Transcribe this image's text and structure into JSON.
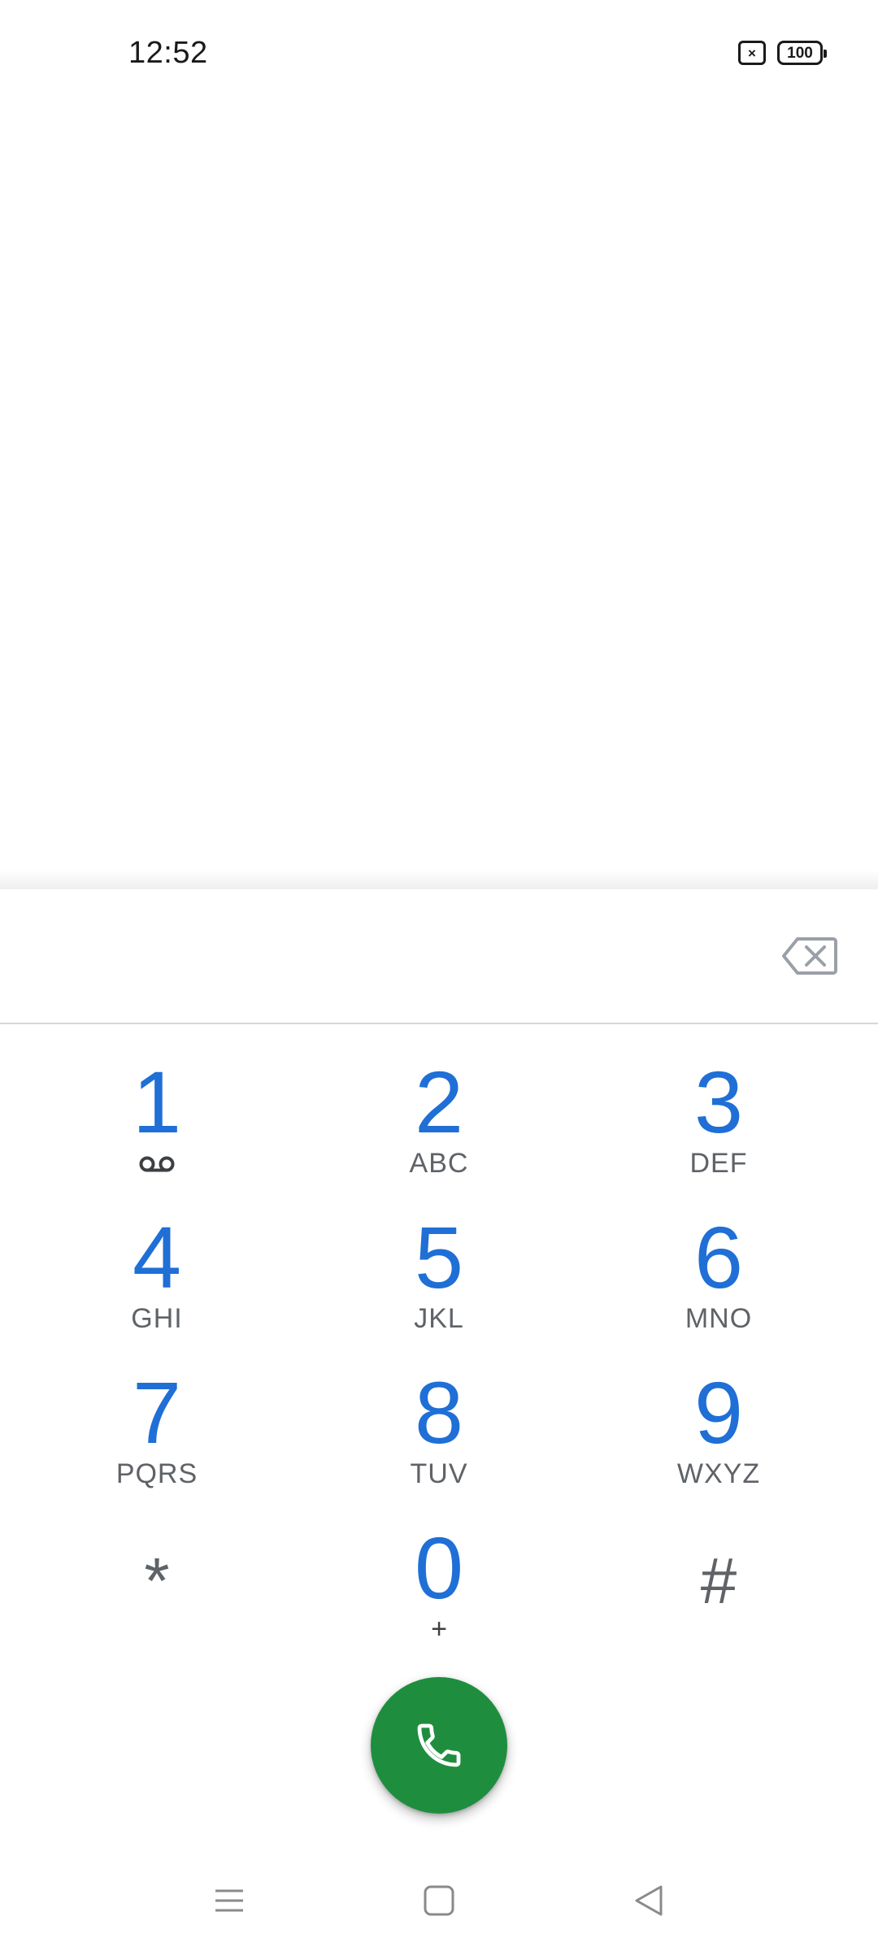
{
  "status_bar": {
    "time": "12:52",
    "sim_icon": "no-sim-icon",
    "battery_level": "100"
  },
  "number_field": {
    "value": "",
    "backspace_icon": "backspace-icon"
  },
  "keypad": {
    "keys": [
      {
        "digit": "1",
        "letters": "",
        "sub_icon": "voicemail-icon"
      },
      {
        "digit": "2",
        "letters": "ABC"
      },
      {
        "digit": "3",
        "letters": "DEF"
      },
      {
        "digit": "4",
        "letters": "GHI"
      },
      {
        "digit": "5",
        "letters": "JKL"
      },
      {
        "digit": "6",
        "letters": "MNO"
      },
      {
        "digit": "7",
        "letters": "PQRS"
      },
      {
        "digit": "8",
        "letters": "TUV"
      },
      {
        "digit": "9",
        "letters": "WXYZ"
      },
      {
        "digit": "*",
        "letters": ""
      },
      {
        "digit": "0",
        "letters": "+"
      },
      {
        "digit": "#",
        "letters": ""
      }
    ]
  },
  "call_button": {
    "icon": "phone-icon",
    "color": "#1e8e3e"
  },
  "nav_bar": {
    "menu_icon": "menu-icon",
    "home_icon": "home-icon",
    "back_icon": "back-icon"
  },
  "colors": {
    "digit": "#1f6fd6",
    "letters": "#5f6368",
    "call": "#1e8e3e"
  }
}
